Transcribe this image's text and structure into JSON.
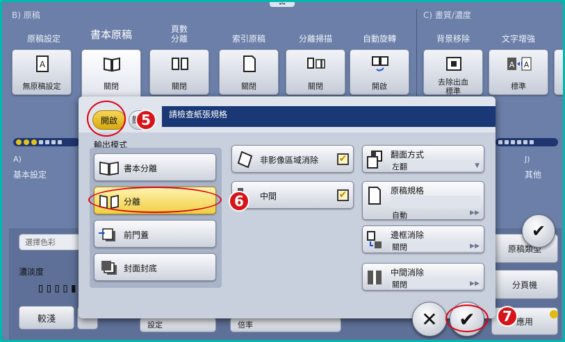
{
  "background": {
    "section_b": "B) 原稿",
    "section_c": "C) 畫質/濃度",
    "columns": [
      {
        "label": "原稿設定",
        "value": "無原稿設定",
        "icon": "document-a-icon"
      },
      {
        "label": "書本原稿",
        "value": "關閉",
        "icon": "open-book-icon"
      },
      {
        "label": "頁數\n分離",
        "value": "關閉",
        "icon": "two-pages-icon"
      },
      {
        "label": "索引原稿",
        "value": "關閉",
        "icon": "index-document-icon"
      },
      {
        "label": "分離掃描",
        "value": "關閉",
        "icon": "separate-scan-icon"
      },
      {
        "label": "自動旋轉",
        "value": "開啟",
        "icon": "auto-rotate-icon"
      },
      {
        "label": "背景移除",
        "value": "去除出血\n標準",
        "icon": "background-remove-icon"
      },
      {
        "label": "文字增強",
        "value": "標準",
        "icon": "text-enhance-icon"
      }
    ],
    "section_a": "A)",
    "basic_settings": "基本設定",
    "section_j": "J)",
    "other": "其他",
    "select_color_placeholder": "選擇色彩",
    "density_label": "濃淡度",
    "lighter_button": "較淺",
    "original_type_button": "原稿類型",
    "paging_button": "分頁機",
    "apply_button": "應用",
    "setting_field": "設定",
    "ratio_field": "倍率"
  },
  "dialog": {
    "on_toggle": "開啟",
    "off_toggle_partial": "關",
    "header_message": "請檢查紙張規格",
    "output_mode_title": "輸出模式",
    "output_modes": [
      {
        "label": "書本分離",
        "icon": "book-spread-icon",
        "selected": false
      },
      {
        "label": "分離",
        "icon": "split-pages-icon",
        "selected": true
      },
      {
        "label": "前門蓋",
        "icon": "front-cover-icon",
        "selected": false
      },
      {
        "label": "封面封底",
        "icon": "front-back-cover-icon",
        "selected": false
      }
    ],
    "checks": [
      {
        "label": "非影像區域消除",
        "checked": true
      },
      {
        "label": "中間",
        "checked": true
      }
    ],
    "settings": [
      {
        "label": "翻面方式",
        "value": "左翻"
      },
      {
        "label": "原稿規格",
        "value": "自動"
      },
      {
        "label": "邊框消除",
        "value": "關閉"
      },
      {
        "label": "中間消除",
        "value": "關閉"
      }
    ],
    "cancel_glyph": "✕",
    "ok_glyph": "✔"
  },
  "annotations": {
    "step5": "5",
    "step6": "6",
    "step7": "7"
  },
  "colors": {
    "accent_yellow": "#f0cf44",
    "title_bar": "#1a3776",
    "highlight_red": "#e00010"
  }
}
